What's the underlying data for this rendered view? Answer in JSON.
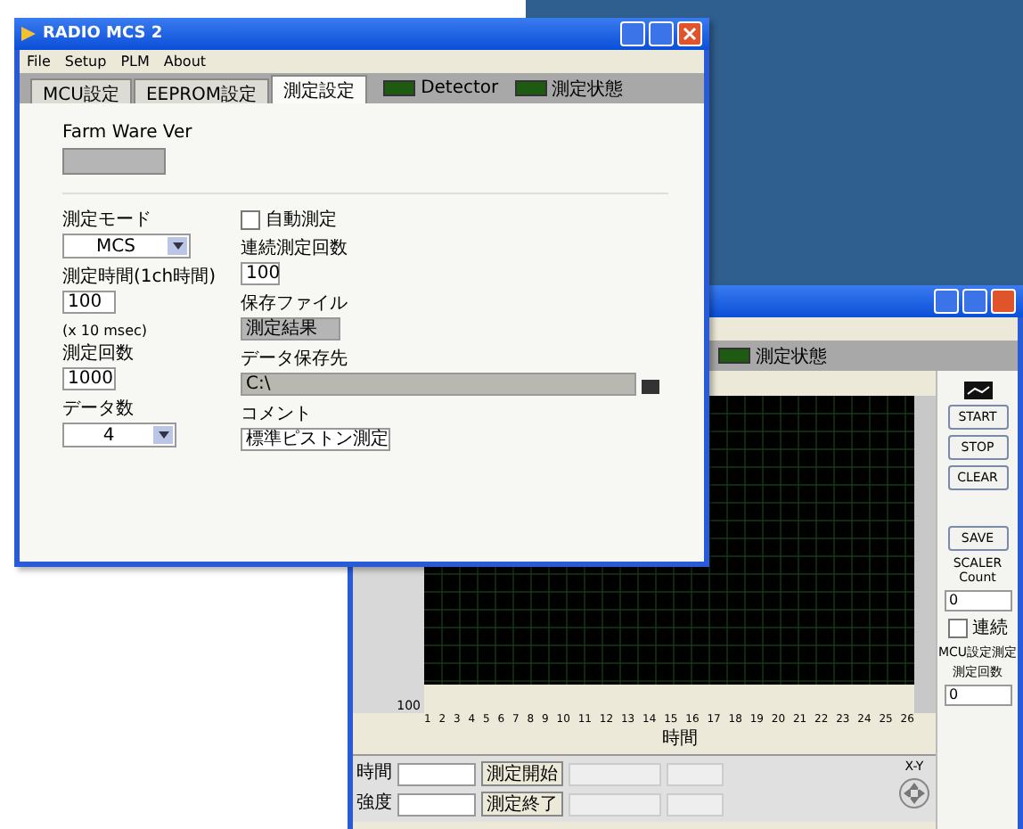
{
  "front_window": {
    "title": "RADIO MCS 2",
    "menu": [
      "File",
      "Setup",
      "PLM",
      "About"
    ],
    "tabs": [
      {
        "label": "MCU設定",
        "selected": false
      },
      {
        "label": "EEPROM設定",
        "selected": false
      },
      {
        "label": "測定設定",
        "selected": true
      }
    ],
    "indicators": [
      {
        "label": "Detector",
        "on": true
      },
      {
        "label": "測定状態",
        "on": true
      }
    ],
    "firmware_label": "Farm Ware Ver",
    "left_fields": [
      {
        "kind": "dropdown",
        "label": "測定モード",
        "value": "MCS"
      },
      {
        "kind": "input",
        "label": "測定時間(1ch時間)",
        "value": "100",
        "note": "(x 10 msec)"
      },
      {
        "kind": "input",
        "label": "測定回数",
        "value": "1000"
      },
      {
        "kind": "dropdown",
        "label": "データ数",
        "value": "4"
      }
    ],
    "auto": {
      "label": "自動測定",
      "checked": false
    },
    "right_fields": [
      {
        "kind": "input",
        "label": "連続測定回数",
        "value": "100"
      },
      {
        "kind": "readonly",
        "label": "保存ファイル",
        "value": "測定結果"
      },
      {
        "kind": "path",
        "label": "データ保存先",
        "value": "C:\\"
      },
      {
        "kind": "wide",
        "label": "コメント",
        "value": "標準ピストン測定"
      }
    ]
  },
  "back_window": {
    "indicator": {
      "label": "測定状態",
      "on": true
    },
    "y_tick": "100",
    "x_ticks": [
      "1",
      "2",
      "3",
      "4",
      "5",
      "6",
      "7",
      "8",
      "9",
      "10",
      "11",
      "12",
      "13",
      "14",
      "15",
      "16",
      "17",
      "18",
      "19",
      "20",
      "21",
      "22",
      "23",
      "24",
      "25",
      "26"
    ],
    "x_label": "時間",
    "rows": [
      {
        "label": "時間",
        "button": "測定開始"
      },
      {
        "label": "強度",
        "button": "測定終了"
      }
    ],
    "xy_label": "X-Y",
    "buttons": [
      "START",
      "STOP",
      "CLEAR"
    ],
    "save": "SAVE",
    "scaler": {
      "label": "SCALER Count",
      "value": "0"
    },
    "continuous": {
      "label": "連続",
      "checked": false
    },
    "mcu": {
      "title": "MCU設定測定",
      "label": "測定回数",
      "value": "0"
    }
  }
}
